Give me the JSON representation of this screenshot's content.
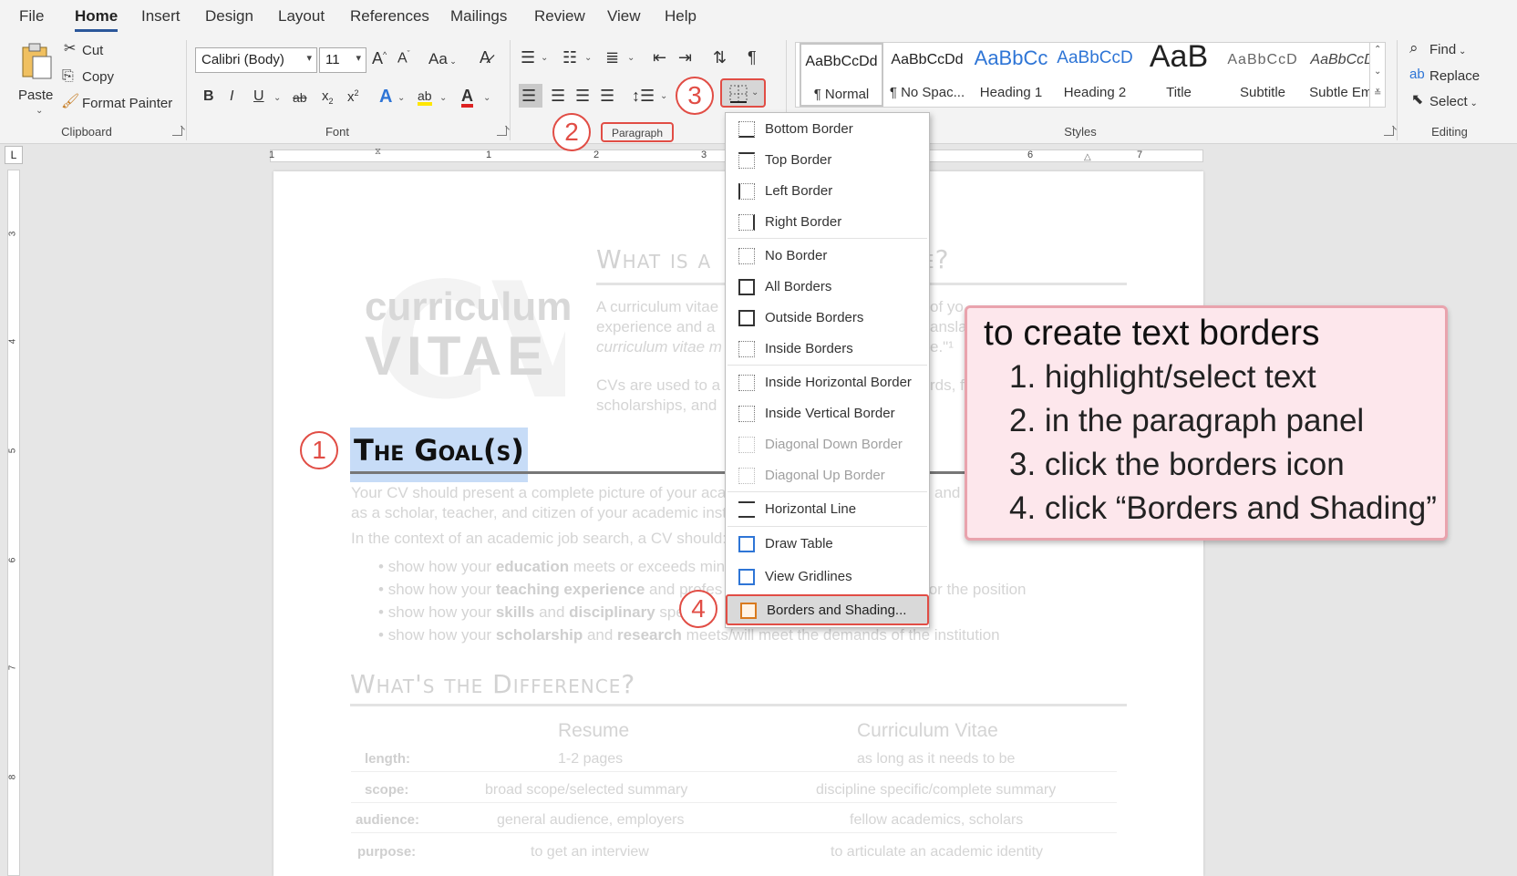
{
  "tabs": [
    "File",
    "Home",
    "Insert",
    "Design",
    "Layout",
    "References",
    "Mailings",
    "Review",
    "View",
    "Help"
  ],
  "active_tab": "Home",
  "clipboard": {
    "paste": "Paste",
    "cut": "Cut",
    "copy": "Copy",
    "format_painter": "Format Painter",
    "label": "Clipboard"
  },
  "font": {
    "family": "Calibri (Body)",
    "size": "11",
    "grow": "A",
    "shrink": "A",
    "case": "Aa",
    "bold": "B",
    "italic": "I",
    "underline": "U",
    "strike": "ab",
    "subscript": "x",
    "superscript": "x",
    "effects": "A",
    "highlight": "ab",
    "color": "A",
    "label": "Font"
  },
  "paragraph": {
    "label": "Paragraph"
  },
  "styles": {
    "label": "Styles",
    "items": [
      {
        "sample": "AaBbCcDd",
        "name": "¶ Normal"
      },
      {
        "sample": "AaBbCcDd",
        "name": "¶ No Spac..."
      },
      {
        "sample": "AaBbCc",
        "name": "Heading 1"
      },
      {
        "sample": "AaBbCcD",
        "name": "Heading 2"
      },
      {
        "sample": "AaB",
        "name": "Title"
      },
      {
        "sample": "AaBbCcD",
        "name": "Subtitle"
      },
      {
        "sample": "AaBbCcDd",
        "name": "Subtle Em..."
      }
    ]
  },
  "editing": {
    "find": "Find",
    "replace": "Replace",
    "select": "Select",
    "label": "Editing"
  },
  "ruler": {
    "marks": [
      "1",
      "1",
      "2",
      "3",
      "6",
      "7"
    ],
    "vmarks": [
      "3",
      "4",
      "5",
      "6",
      "7",
      "8"
    ],
    "corner": "L"
  },
  "document": {
    "logo_top": "curriculum",
    "logo_bottom": "VITAE",
    "heading1": "What is a",
    "heading1_tail": "e?",
    "intro_lines": [
      "A curriculum vitae",
      "experience and a",
      "curriculum vitae m"
    ],
    "intro_tails": [
      "of yo",
      "anslate",
      "e.\"¹"
    ],
    "cv_use_line1": "CVs are used to a",
    "cv_use_line1_tail": "rds, f",
    "cv_use_line2": "scholarships, and",
    "goal_heading": "The Goal(s)",
    "goal_para1": "Your CV should present a complete picture of your acade",
    "goal_para1_tail": "and",
    "goal_para2": "as a scholar, teacher, and citizen of your academic institu",
    "context": "In the context of an academic job search, a CV should:",
    "bullets": [
      {
        "pre": "show how your ",
        "bold": "education",
        "post": " meets or exceeds minin"
      },
      {
        "pre": "show how your ",
        "bold": "teaching experience",
        "post": " and profes",
        "tail": "for the position"
      },
      {
        "pre": "show how your ",
        "bold": "skills",
        "post": " and ",
        "bold2": "disciplinary",
        "post2": " spec"
      },
      {
        "pre": "show how your ",
        "bold": "scholarship",
        "post": " and ",
        "bold2": "research",
        "post2": " meets/will meet the demands of the institution"
      }
    ],
    "heading2": "What's the Difference?",
    "table": {
      "headers": [
        "Resume",
        "Curriculum Vitae"
      ],
      "rows": [
        {
          "label": "length:",
          "resume": "1-2 pages",
          "cv": "as long as it needs to be"
        },
        {
          "label": "scope:",
          "resume": "broad scope/selected summary",
          "cv": "discipline specific/complete summary"
        },
        {
          "label": "audience:",
          "resume": "general audience, employers",
          "cv": "fellow academics, scholars"
        },
        {
          "label": "purpose:",
          "resume": "to get an interview",
          "cv": "to articulate an academic identity"
        }
      ]
    }
  },
  "borders_menu": {
    "items": [
      "Bottom Border",
      "Top Border",
      "Left Border",
      "Right Border",
      "No Border",
      "All Borders",
      "Outside Borders",
      "Inside Borders",
      "Inside Horizontal Border",
      "Inside Vertical Border",
      "Diagonal Down Border",
      "Diagonal Up Border",
      "Horizontal Line",
      "Draw Table",
      "View Gridlines",
      "Borders and Shading..."
    ]
  },
  "callouts": [
    "1",
    "2",
    "3",
    "4"
  ],
  "instructions": {
    "title": "to create text borders",
    "steps": [
      "1. highlight/select text",
      "2. in the paragraph panel",
      "3. click the borders icon",
      "4. click “Borders and Shading”"
    ]
  },
  "colors": {
    "accent": "#2b579a",
    "callout_red": "#e14d45",
    "panel_bg": "#fde7ec",
    "selection": "#c7dcf7"
  }
}
